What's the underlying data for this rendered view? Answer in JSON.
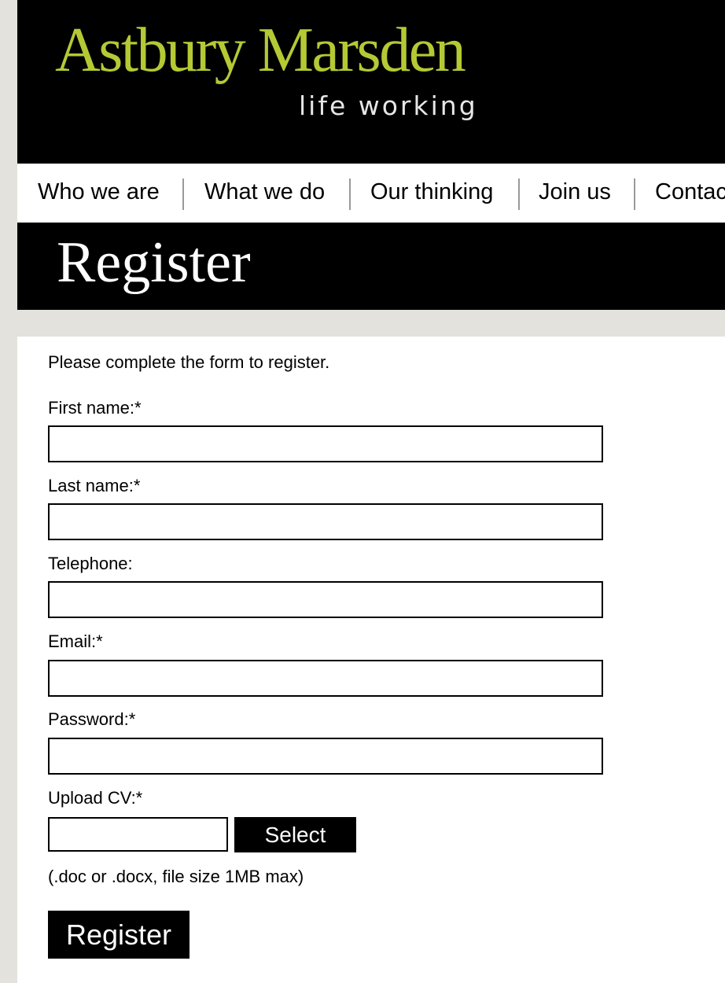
{
  "header": {
    "logo": "Astbury Marsden",
    "tagline": "life working",
    "logo_color": "#b5c934"
  },
  "nav": {
    "items": [
      "Who we are",
      "What we do",
      "Our thinking",
      "Join us",
      "Contac"
    ]
  },
  "page": {
    "title": "Register"
  },
  "form": {
    "intro": "Please complete the form to register.",
    "fields": {
      "first_name": {
        "label": "First name:*",
        "value": ""
      },
      "last_name": {
        "label": "Last name:*",
        "value": ""
      },
      "telephone": {
        "label": "Telephone:",
        "value": ""
      },
      "email": {
        "label": "Email:*",
        "value": ""
      },
      "password": {
        "label": "Password:*",
        "value": ""
      }
    },
    "cv": {
      "label": "Upload CV:*",
      "value": "",
      "select_label": "Select",
      "hint": "(.doc or .docx, file size 1MB max)"
    },
    "submit_label": "Register"
  }
}
